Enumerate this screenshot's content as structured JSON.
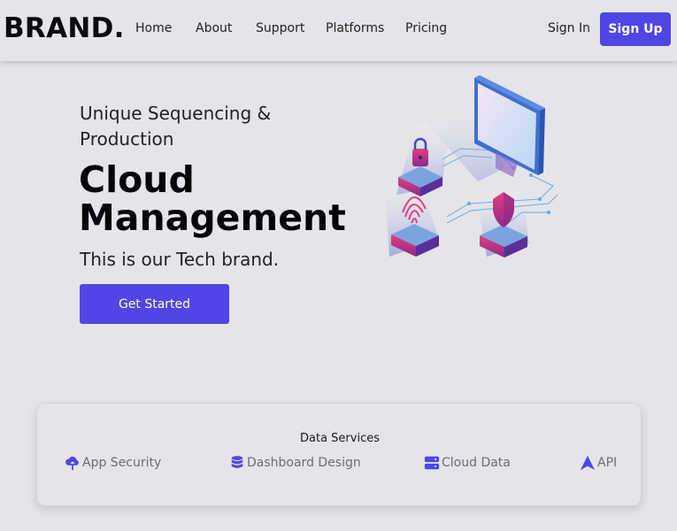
{
  "nav": {
    "brand": "BRAND.",
    "links": [
      "Home",
      "About",
      "Support",
      "Platforms",
      "Pricing"
    ],
    "sign_in": "Sign In",
    "sign_up": "Sign Up"
  },
  "hero": {
    "tagline": "Unique Sequencing & Production",
    "headline": "Cloud Management",
    "subline": "This is our Tech brand.",
    "cta": "Get Started"
  },
  "services": {
    "title": "Data Services",
    "items": [
      {
        "label": "App Security",
        "icon": "cloud-upload-icon"
      },
      {
        "label": "Dashboard Design",
        "icon": "database-icon"
      },
      {
        "label": "Cloud Data",
        "icon": "server-icon"
      },
      {
        "label": "API",
        "icon": "api-triangle-icon"
      }
    ]
  },
  "colors": {
    "accent": "#4f46e5",
    "background": "#e5e4e8",
    "service_text": "#6b6b7a"
  }
}
